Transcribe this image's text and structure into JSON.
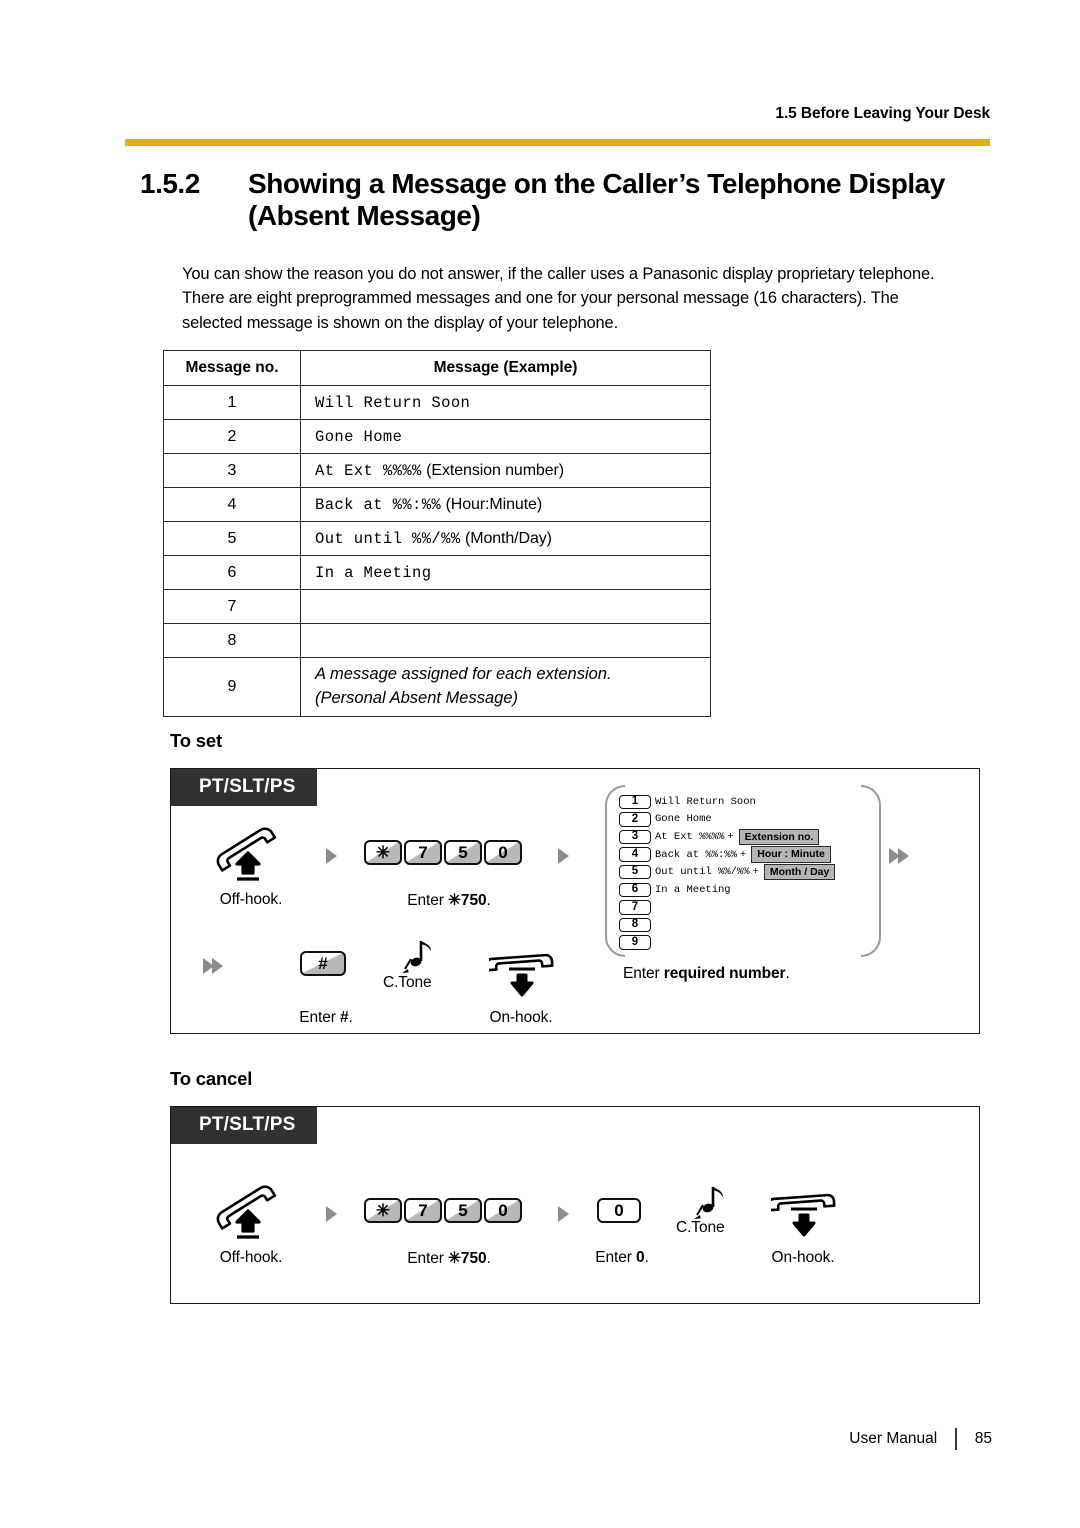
{
  "header": {
    "running_head": "1.5 Before Leaving Your Desk",
    "rule_color": "#E0B207"
  },
  "section": {
    "number": "1.5.2",
    "title": "Showing a Message on the Caller’s Telephone Display (Absent Message)"
  },
  "intro": "You can show the reason you do not answer, if the caller uses a Panasonic display proprietary telephone. There are eight preprogrammed messages and one for your personal message (16 characters). The selected message is shown on the display of your telephone.",
  "table": {
    "headers": [
      "Message no.",
      "Message (Example)"
    ],
    "rows": [
      {
        "no": "1",
        "mono": "Will Return Soon",
        "paren": ""
      },
      {
        "no": "2",
        "mono": "Gone Home",
        "paren": ""
      },
      {
        "no": "3",
        "mono": "At Ext %%%%",
        "paren": "(Extension number)"
      },
      {
        "no": "4",
        "mono": "Back at %%:%%",
        "paren": "(Hour:Minute)"
      },
      {
        "no": "5",
        "mono": "Out until %%/%%",
        "paren": "(Month/Day)"
      },
      {
        "no": "6",
        "mono": "In a Meeting",
        "paren": ""
      },
      {
        "no": "7",
        "mono": "",
        "paren": ""
      },
      {
        "no": "8",
        "mono": "",
        "paren": ""
      },
      {
        "no": "9",
        "italic_line1": "A message assigned for each extension.",
        "italic_line2": "(Personal Absent Message)"
      }
    ]
  },
  "to_set": {
    "heading": "To set",
    "device_tag": "PT/SLT/PS",
    "step_offhook_caption": "Off-hook.",
    "keys_750": [
      "✳",
      "7",
      "5",
      "0"
    ],
    "step_750_caption_pre": "Enter ",
    "step_750_caption_code": "✳750",
    "step_750_caption_post": ".",
    "key_hash": "#",
    "step_hash_caption_pre": "Enter ",
    "step_hash_caption_code": "#",
    "step_hash_caption_post": ".",
    "ctone_label": "C.Tone",
    "step_onhook_caption": "On-hook.",
    "list_caption_pre": "Enter ",
    "list_caption_bold": "required number",
    "list_caption_post": ".",
    "messages": [
      {
        "no": "1",
        "text": "Will Return Soon",
        "plus": "",
        "badge": ""
      },
      {
        "no": "2",
        "text": "Gone Home",
        "plus": "",
        "badge": ""
      },
      {
        "no": "3",
        "text": "At Ext %%%%",
        "plus": "+",
        "badge": "Extension no."
      },
      {
        "no": "4",
        "text": "Back at %%:%%",
        "plus": "+",
        "badge": "Hour : Minute"
      },
      {
        "no": "5",
        "text": "Out until %%/%%",
        "plus": "+",
        "badge": "Month / Day"
      },
      {
        "no": "6",
        "text": "In a Meeting",
        "plus": "",
        "badge": ""
      },
      {
        "no": "7",
        "text": "",
        "plus": "",
        "badge": ""
      },
      {
        "no": "8",
        "text": "",
        "plus": "",
        "badge": ""
      },
      {
        "no": "9",
        "text": "",
        "plus": "",
        "badge": ""
      }
    ]
  },
  "to_cancel": {
    "heading": "To cancel",
    "device_tag": "PT/SLT/PS",
    "step_offhook_caption": "Off-hook.",
    "keys_750": [
      "✳",
      "7",
      "5",
      "0"
    ],
    "step_750_caption_pre": "Enter ",
    "step_750_caption_code": "✳750",
    "step_750_caption_post": ".",
    "key_zero": "0",
    "step_zero_caption_pre": "Enter ",
    "step_zero_caption_code": "0",
    "step_zero_caption_post": ".",
    "ctone_label": "C.Tone",
    "step_onhook_caption": "On-hook."
  },
  "footer": {
    "manual_label": "User Manual",
    "page_number": "85"
  }
}
